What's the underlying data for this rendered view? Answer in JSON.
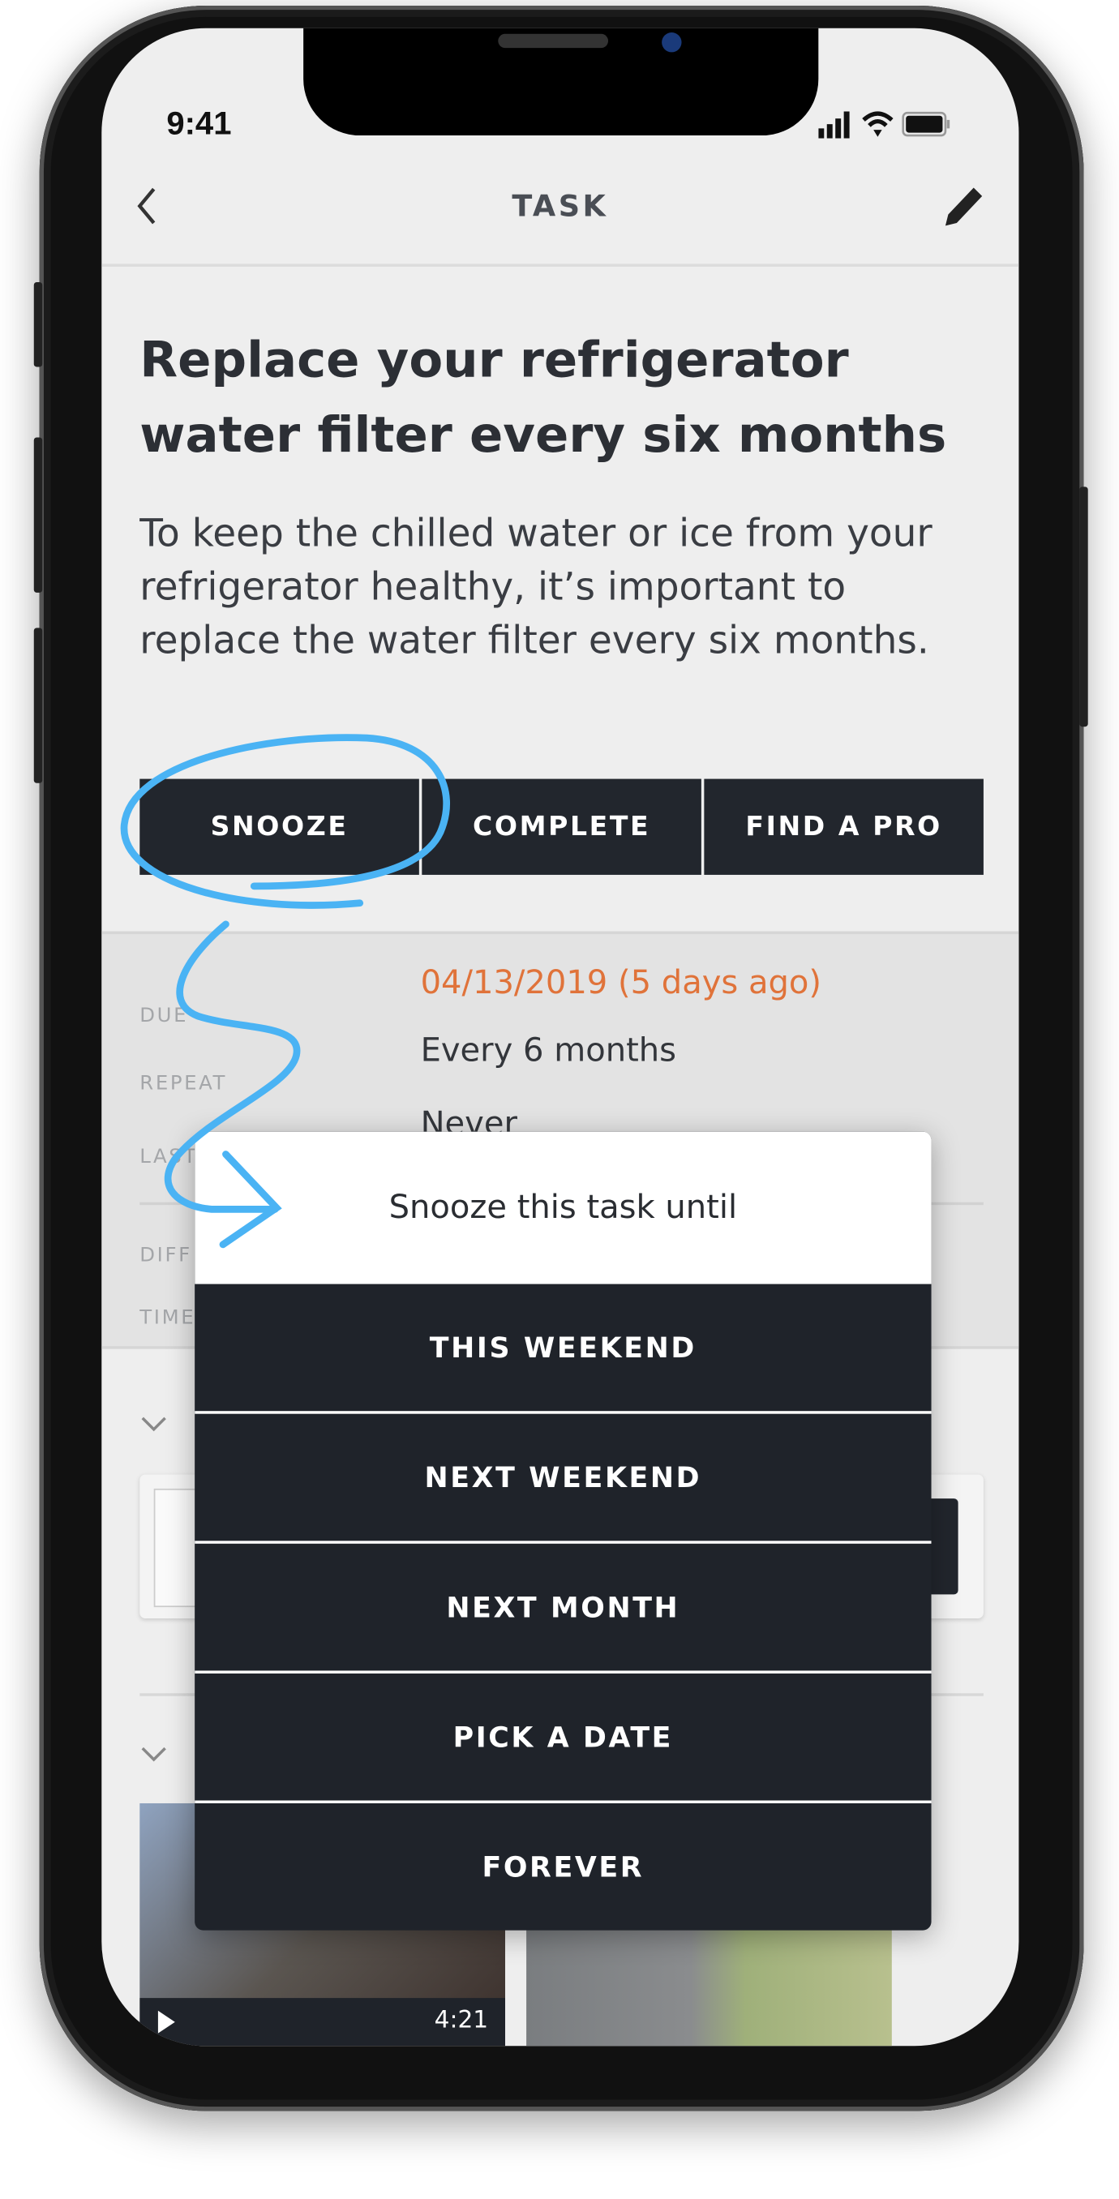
{
  "status_bar": {
    "time": "9:41"
  },
  "nav": {
    "title": "TASK",
    "back_icon": "chevron-left-icon",
    "edit_icon": "pencil-icon"
  },
  "task": {
    "title": "Replace your refrigerator water filter every six months",
    "description": "To keep the chilled water or ice from your refrigerator healthy, it’s important to replace the water filter every six months."
  },
  "actions": {
    "snooze": "SNOOZE",
    "complete": "COMPLETE",
    "find_pro": "FIND A PRO"
  },
  "details": [
    {
      "label": "DUE",
      "value": "04/13/2019 (5 days ago)"
    },
    {
      "label": "REPEAT",
      "value": "Every 6 months"
    },
    {
      "label": "LAST COMPLETED",
      "value": "Never"
    },
    {
      "label": "DIFF",
      "value": ""
    },
    {
      "label": "TIME",
      "value": ""
    }
  ],
  "colors": {
    "overdue": "#e0733a",
    "dark": "#1f232a",
    "annotation": "#4ab3f4"
  },
  "video": {
    "duration": "4:21"
  },
  "snooze_popup": {
    "title": "Snooze this task until",
    "options": [
      "THIS WEEKEND",
      "NEXT WEEKEND",
      "NEXT MONTH",
      "PICK A DATE",
      "FOREVER"
    ]
  }
}
